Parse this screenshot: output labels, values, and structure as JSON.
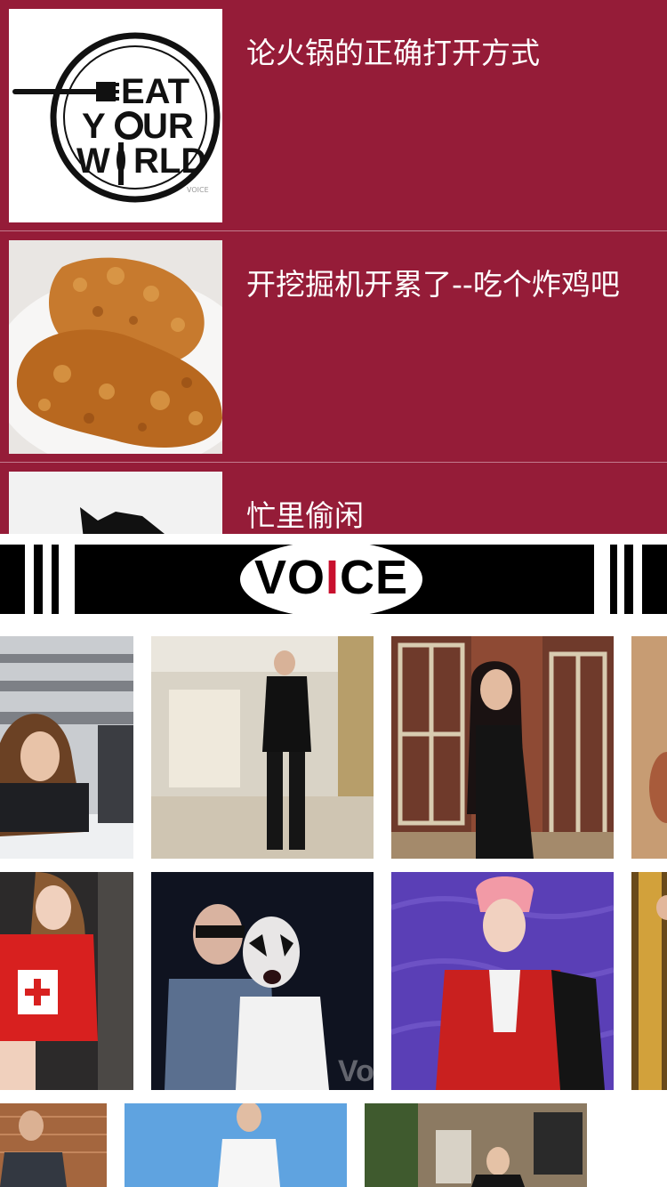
{
  "articles": [
    {
      "title": "论火锅的正确打开方式",
      "thumb_icon": "eat-your-world-logo",
      "logo_text": [
        "EAT",
        "Y",
        "UR",
        "W",
        "RLD"
      ],
      "watermark": "VOICE"
    },
    {
      "title": "开挖掘机开累了--吃个炸鸡吧",
      "thumb_icon": "fried-chicken-photo"
    },
    {
      "title": "忙里偷闲",
      "thumb_icon": "silhouette-photo"
    }
  ],
  "banner": {
    "word_pre": "VO",
    "word_i": "I",
    "word_post": "CE",
    "accent": "#c8102e"
  },
  "photos": {
    "row1": [
      "classroom-girl-photo",
      "hallway-man-photo",
      "window-girl-photo",
      "partial-photo"
    ],
    "row2": [
      "nurse-costume-photo",
      "halloween-party-photo",
      "red-blazer-man-photo",
      "gold-pillar-photo"
    ],
    "row3": [
      "brick-wall-boy-photo",
      "sky-man-photo",
      "building-girl-photo"
    ],
    "watermark": "Vo"
  },
  "colors": {
    "list_bg": "#951c38",
    "title": "#ffffff"
  }
}
